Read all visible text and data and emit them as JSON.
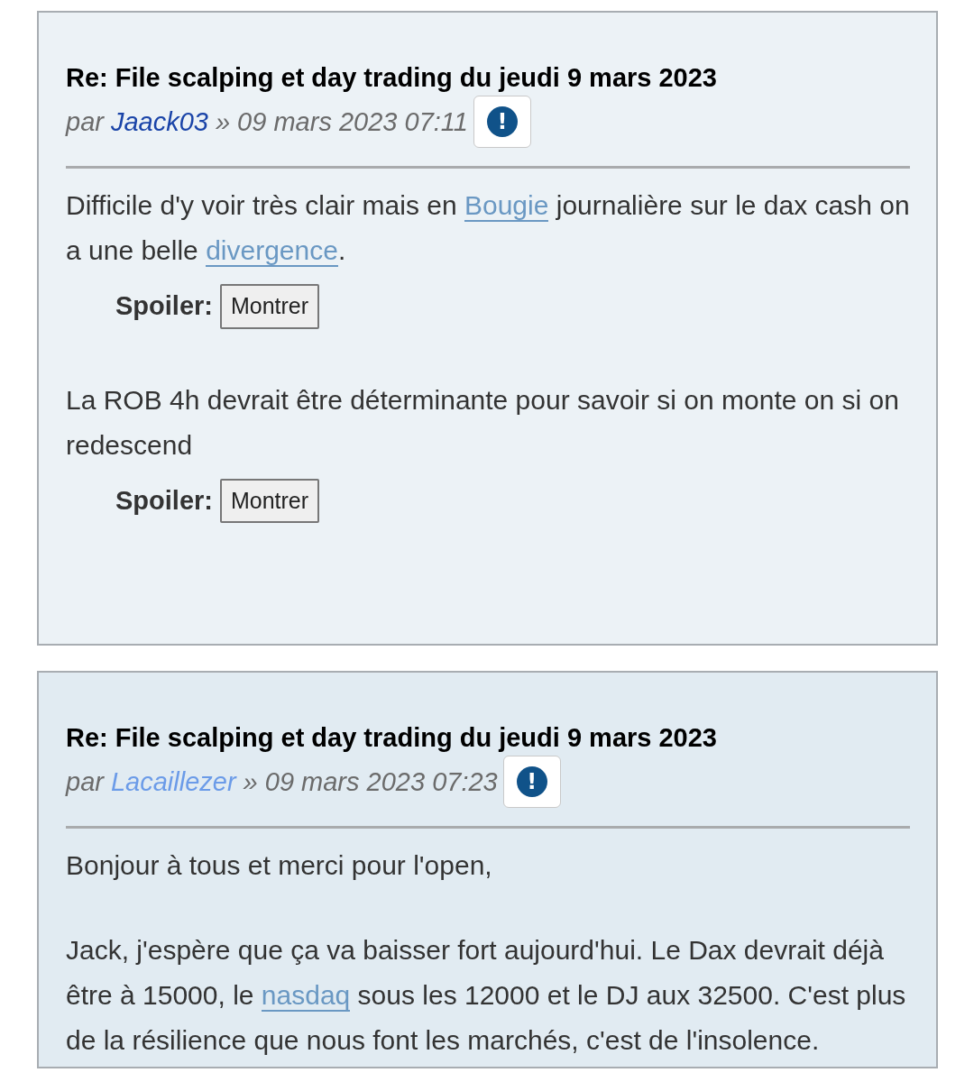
{
  "posts": [
    {
      "title": "Re: File scalping et day trading du jeudi 9 mars 2023",
      "by": "par",
      "author": {
        "name": "Jaack03",
        "color": "#1a44a8"
      },
      "separator": "»",
      "date": "09 mars 2023 07:11",
      "color": "#ecf2f6",
      "report_icon": "!",
      "body": [
        {
          "kind": "text",
          "segments": [
            {
              "text": "Difficile d'y voir très clair mais en "
            },
            {
              "link": "Bougie"
            },
            {
              "text": " journalière sur le dax cash on a une belle "
            },
            {
              "link": "divergence"
            },
            {
              "text": "."
            }
          ]
        },
        {
          "kind": "spoiler",
          "label": "Spoiler:",
          "button": "Montrer"
        },
        {
          "kind": "text",
          "segments": [
            {
              "text": "La ROB 4h devrait être déterminante pour savoir si on monte on si on redescend"
            }
          ]
        },
        {
          "kind": "spoiler",
          "label": "Spoiler:",
          "button": "Montrer"
        }
      ]
    },
    {
      "title": "Re: File scalping et day trading du jeudi 9 mars 2023",
      "by": "par",
      "author": {
        "name": "Lacaillezer",
        "color": "#6b9be8"
      },
      "separator": "»",
      "date": "09 mars 2023 07:23",
      "color": "#e1ebf2",
      "report_icon": "!",
      "body": [
        {
          "kind": "text",
          "segments": [
            {
              "text": "Bonjour à tous et merci pour l'open,"
            }
          ]
        },
        {
          "kind": "text",
          "segments": [
            {
              "text": "Jack, j'espère que ça va baisser fort aujourd'hui. Le Dax devrait déjà être à 15000, le "
            },
            {
              "link": "nasdaq"
            },
            {
              "text": " sous les 12000 et le DJ aux 32500. C'est plus de la résilience que nous font les marchés, c'est de l'insolence."
            }
          ]
        }
      ]
    }
  ]
}
